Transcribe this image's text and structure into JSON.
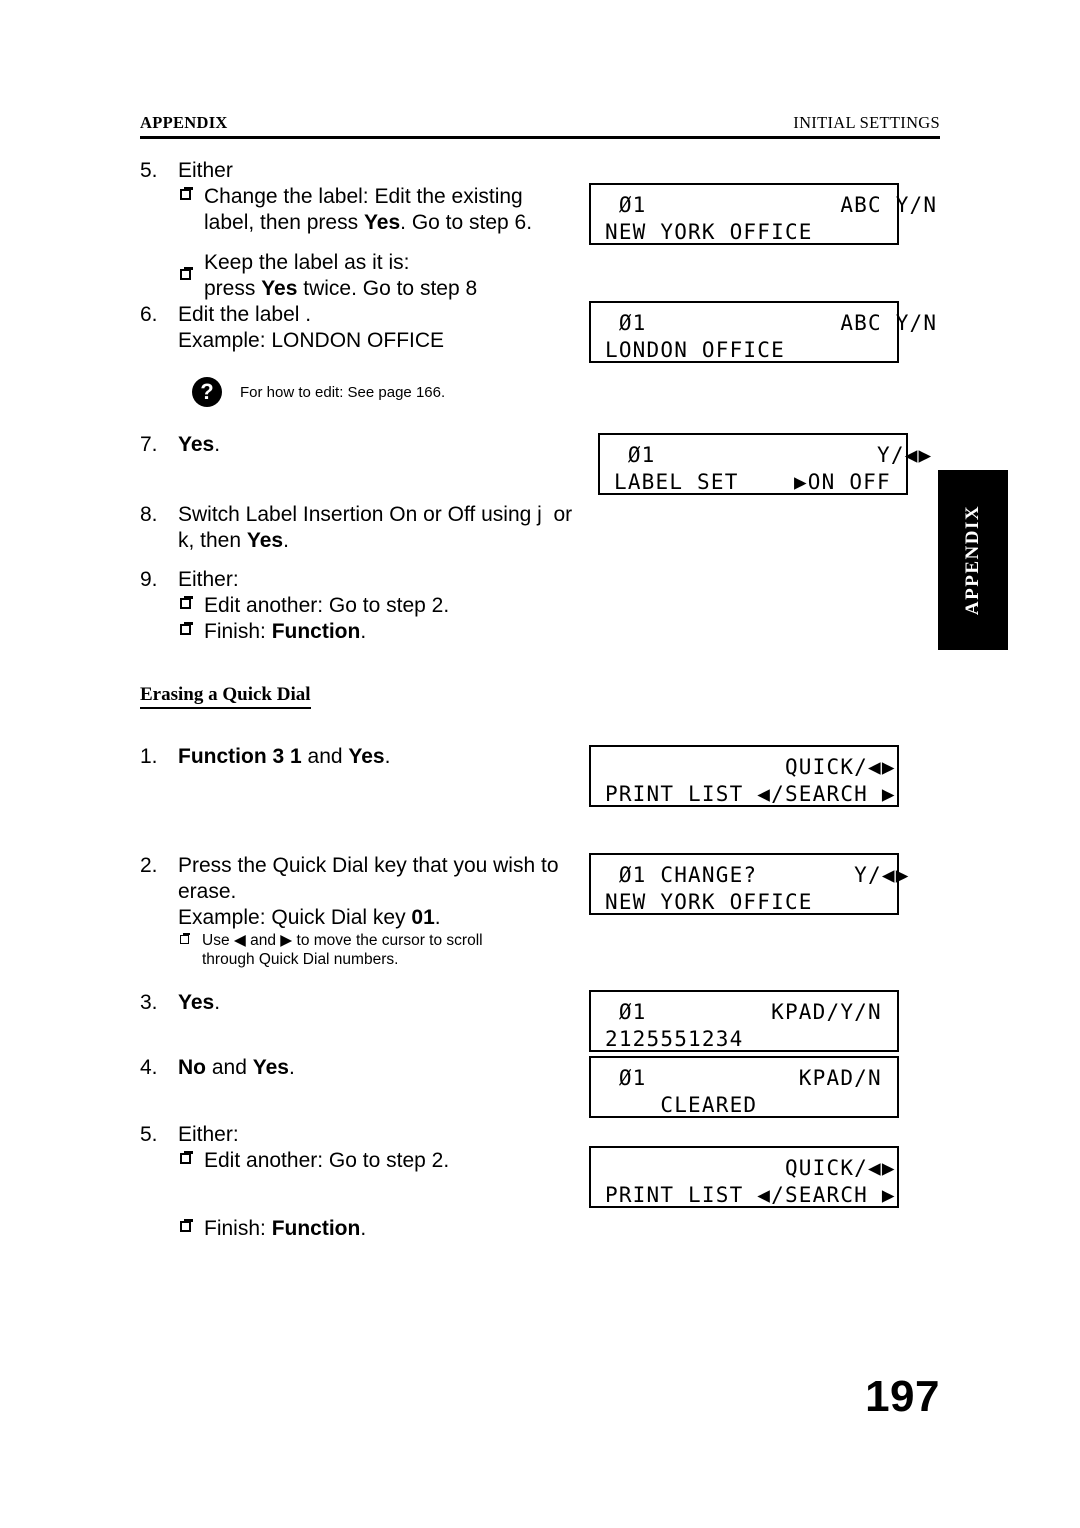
{
  "header": {
    "left": "APPENDIX",
    "right": "INITIAL SETTINGS"
  },
  "folio": "197",
  "thumb_tab": {
    "label": "APPENDIX"
  },
  "steps": [
    {
      "num": "5.",
      "line1": "Either",
      "bullet1_line1": "Change the label: Edit the existing",
      "bullet1_line2_a": "label, then press ",
      "bullet1_line2_b": "Yes",
      "bullet1_line2_c": ". Go to step 6.",
      "bullet2_line1": "Keep the label as it is:",
      "bullet2_line2_a": "press ",
      "bullet2_line2_b": "Yes",
      "bullet2_line2_c": " twice. Go to step 8"
    },
    {
      "num": "6.",
      "line1": "Edit the label .",
      "line2": "Example: LONDON OFFICE"
    },
    {
      "num": "7.",
      "bold": "Yes",
      "tail": "."
    },
    {
      "num": "8.",
      "line1": "Switch Label Insertion On or Off using j  or",
      "line2_a": "k, then ",
      "line2_b": "Yes",
      "line2_c": "."
    },
    {
      "num": "9.",
      "line1": "Either:",
      "bullet1": "Edit another: Go to step 2.",
      "bullet2_a": "Finish: ",
      "bullet2_b": "Function",
      "bullet2_c": "."
    }
  ],
  "note": {
    "icon": "question-mark-icon",
    "text": "For how to edit: See page 166."
  },
  "section": {
    "title": "Erasing a Quick Dial"
  },
  "erase_steps": [
    {
      "num": "1.",
      "b1": "Function 3 1",
      "mid": " and ",
      "b2": "Yes",
      "tail": "."
    },
    {
      "num": "2.",
      "line1": "Press the Quick Dial key that you wish to",
      "line2": "erase.",
      "line3_a": "Example: Quick Dial key ",
      "line3_b": "01",
      "line3_c": ".",
      "subnote_a": "Use ",
      "subnote_left_arrow": "◀",
      "subnote_b": " and ",
      "subnote_right_arrow": "▶",
      "subnote_c": " to move the cursor to scroll",
      "subnote_line2": "through Quick Dial numbers."
    },
    {
      "num": "3.",
      "bold": "Yes",
      "tail": "."
    },
    {
      "num": "4.",
      "b1": "No",
      "mid": " and ",
      "b2": "Yes",
      "tail": "."
    },
    {
      "num": "5.",
      "line1": "Either:",
      "bullet1": "Edit another: Go to step 2.",
      "bullet2_a": "Finish: ",
      "bullet2_b": "Function",
      "bullet2_c": "."
    }
  ],
  "lcd_panels": [
    {
      "id": "lcd-new-york-abc",
      "line1": " Ø1              ABC Y/N",
      "line2": "NEW YORK OFFICE"
    },
    {
      "id": "lcd-london-abc",
      "line1": " Ø1              ABC Y/N",
      "line2": "LONDON OFFICE"
    },
    {
      "id": "lcd-label-set",
      "line1": " Ø1                Y/◀▶",
      "line2": "LABEL SET    ▶ON OFF"
    },
    {
      "id": "lcd-quick-print-list-1",
      "line1": "             QUICK/◀▶",
      "line2": "PRINT LIST ◀/SEARCH ▶"
    },
    {
      "id": "lcd-change-new-york",
      "line1": " Ø1 CHANGE?       Y/◀▶",
      "line2": "NEW YORK OFFICE"
    },
    {
      "id": "lcd-kpad-number",
      "line1": " Ø1         KPAD/Y/N",
      "line2": "2125551234"
    },
    {
      "id": "lcd-kpad-cleared",
      "line1": " Ø1           KPAD/N",
      "line2": "    CLEARED"
    },
    {
      "id": "lcd-quick-print-list-2",
      "line1": "             QUICK/◀▶",
      "line2": "PRINT LIST ◀/SEARCH ▶"
    }
  ]
}
